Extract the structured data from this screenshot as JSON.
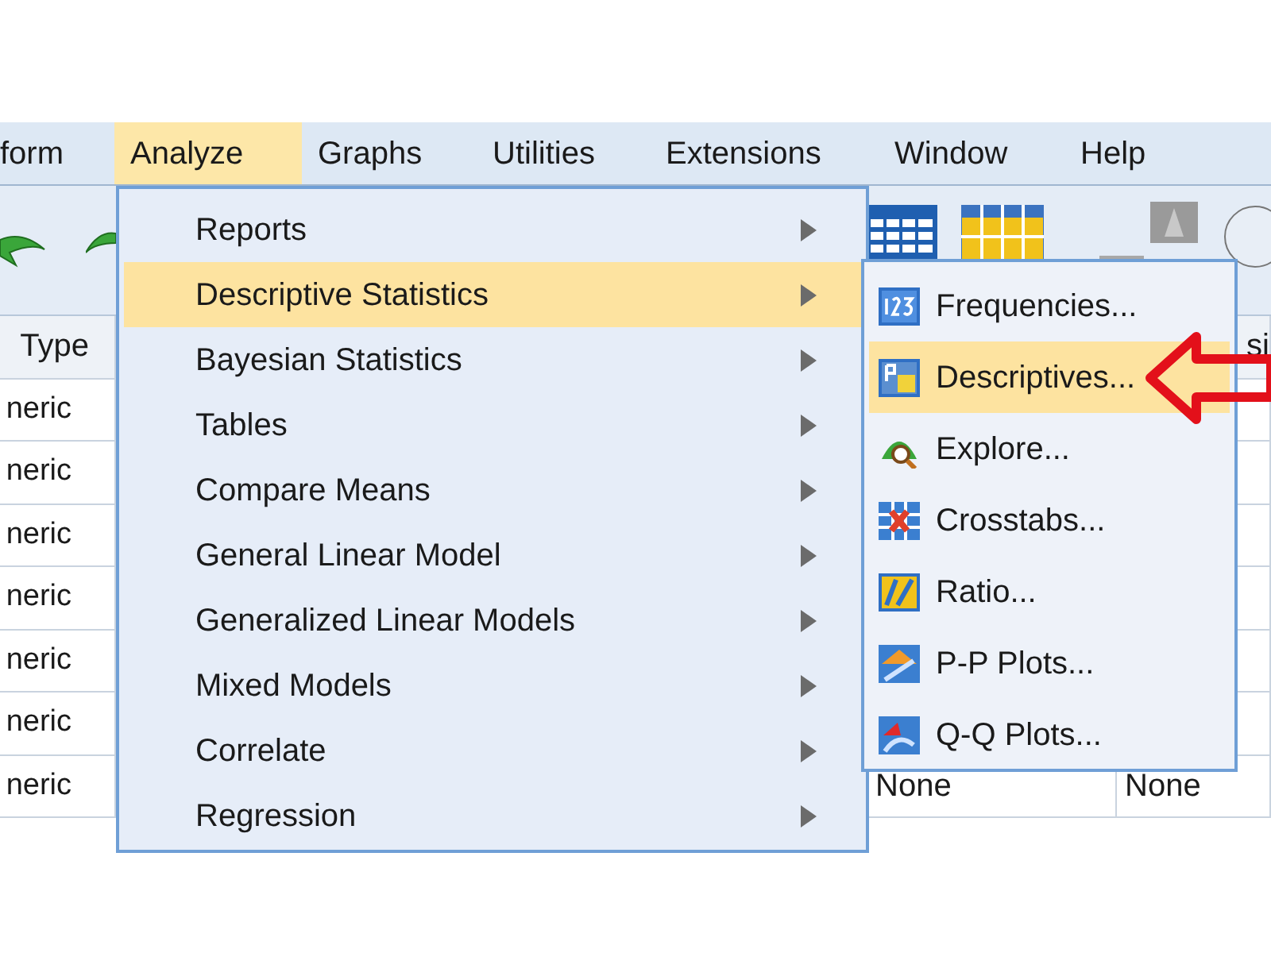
{
  "menubar": [
    {
      "label": "form",
      "selected": false
    },
    {
      "label": "Analyze",
      "selected": true
    },
    {
      "label": "Graphs",
      "selected": false
    },
    {
      "label": "Utilities",
      "selected": false
    },
    {
      "label": "Extensions",
      "selected": false
    },
    {
      "label": "Window",
      "selected": false
    },
    {
      "label": "Help",
      "selected": false
    }
  ],
  "grid": {
    "header": "Type",
    "header_right": "si",
    "rows": [
      {
        "column_1": "neric"
      },
      {
        "column_1": "neric"
      },
      {
        "column_1": "neric"
      },
      {
        "column_1": "neric"
      },
      {
        "column_1": "neric"
      },
      {
        "column_1": "neric"
      },
      {
        "column_1": "neric",
        "column_2": "None",
        "column_3": "None"
      }
    ]
  },
  "analyze_menu": [
    {
      "label": "Reports",
      "selected": false,
      "has_submenu": true
    },
    {
      "label": "Descriptive Statistics",
      "selected": true,
      "has_submenu": true
    },
    {
      "label": "Bayesian Statistics",
      "selected": false,
      "has_submenu": true
    },
    {
      "label": "Tables",
      "selected": false,
      "has_submenu": true
    },
    {
      "label": "Compare Means",
      "selected": false,
      "has_submenu": true
    },
    {
      "label": "General Linear Model",
      "selected": false,
      "has_submenu": true
    },
    {
      "label": "Generalized Linear Models",
      "selected": false,
      "has_submenu": true
    },
    {
      "label": "Mixed Models",
      "selected": false,
      "has_submenu": true
    },
    {
      "label": "Correlate",
      "selected": false,
      "has_submenu": true
    },
    {
      "label": "Regression",
      "selected": false,
      "has_submenu": true
    }
  ],
  "descriptive_submenu": [
    {
      "label": "Frequencies...",
      "selected": false
    },
    {
      "label": "Descriptives...",
      "selected": true
    },
    {
      "label": "Explore...",
      "selected": false
    },
    {
      "label": "Crosstabs...",
      "selected": false
    },
    {
      "label": "Ratio...",
      "selected": false
    },
    {
      "label": "P-P Plots...",
      "selected": false
    },
    {
      "label": "Q-Q Plots...",
      "selected": false
    }
  ]
}
